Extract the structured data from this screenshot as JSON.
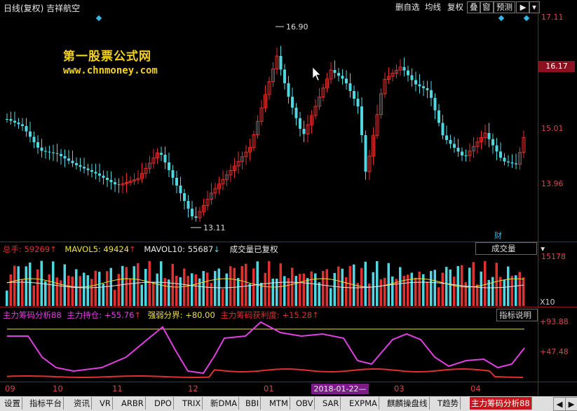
{
  "window": {
    "title": "日线(复权) 吉祥航空",
    "buttons": [
      "删自选",
      "均线",
      "复权",
      "叠",
      "窗",
      "预测"
    ],
    "play_icon": "play-icon",
    "dropdown_icon": "chevron-down-icon"
  },
  "watermark": {
    "line1": "第一股票公式网",
    "line2": "www.chnmoney.com"
  },
  "price_axis": {
    "labels": [
      "17.11",
      "15.01",
      "13.96"
    ],
    "current_price": "16.17",
    "high_marker": "16.90",
    "low_marker": "13.11",
    "cai_label": "财"
  },
  "volume_panel": {
    "items": [
      {
        "label": "总手: ",
        "value": "59269",
        "arrow": "↑",
        "color": "#e03030"
      },
      {
        "label": "MAVOL5: ",
        "value": "49424",
        "arrow": "↑",
        "color": "#f0e040"
      },
      {
        "label": "MAVOL10: ",
        "value": "55687",
        "arrow": "↓",
        "color": "#e8e8e8"
      }
    ],
    "note": "成交量已复权",
    "selector": "成交量",
    "axis_top": "15178",
    "axis_unit": "X10"
  },
  "indicator_panel": {
    "items": [
      {
        "text": "主力筹码分析88",
        "color": "#e040e0"
      },
      {
        "text": "主力持仓: +55.76",
        "arrow": "↑",
        "color": "#e040e0"
      },
      {
        "text": "强弱分界: +80.00",
        "color": "#f0e040"
      },
      {
        "text": "主力筹码获利度: +15.28",
        "arrow": "↑",
        "color": "#e03030"
      }
    ],
    "help_button": "指标说明",
    "axis_labels": [
      "+93.88",
      "+47.48"
    ]
  },
  "time_axis": {
    "labels": [
      "09",
      "10",
      "11",
      "12",
      "01",
      "03",
      "04"
    ],
    "selected_date": "2018-01-22—"
  },
  "bottom_tabs": [
    "设置",
    "指标平台",
    "资讯",
    "VR",
    "ARBR",
    "DPO",
    "TRIX",
    "新DMA",
    "BBI",
    "MTM",
    "OBV",
    "SAR",
    "EXPMA",
    "麒麟操盘线",
    "T趋势",
    "主力筹码分析88"
  ],
  "active_tab": "主力筹码分析88",
  "colors": {
    "up": "#e03030",
    "down": "#4fd6e0",
    "ma5": "#f0e040",
    "ma10": "#e8e8e8",
    "holding": "#e040e0",
    "profit": "#e03030",
    "baseline": "#f0e040",
    "frame": "#8b1a1a"
  }
}
